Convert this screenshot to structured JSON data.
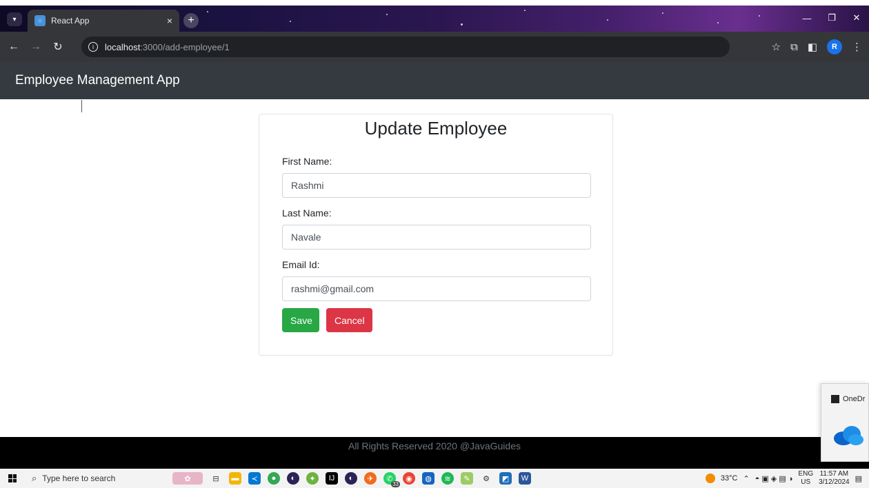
{
  "browser": {
    "tab_title": "React App",
    "tab_close": "×",
    "new_tab": "+",
    "url_host": "localhost",
    "url_path": ":3000/add-employee/1"
  },
  "app": {
    "brand": "Employee Management App"
  },
  "form": {
    "title": "Update Employee",
    "first_name_label": "First Name:",
    "first_name_value": "Rashmi",
    "last_name_label": "Last Name:",
    "last_name_value": "Navale",
    "email_label": "Email Id:",
    "email_value": "rashmi@gmail.com",
    "save_label": "Save",
    "cancel_label": "Cancel"
  },
  "footer": {
    "text": "All Rights Reserved 2020 @JavaGuides"
  },
  "onedrive": {
    "label": "OneDr"
  },
  "taskbar": {
    "search_placeholder": "Type here to search",
    "weather": "33°C",
    "lang_top": "ENG",
    "lang_bottom": "US",
    "time": "11:57 AM",
    "date": "3/12/2024",
    "whatsapp_badge": "33"
  },
  "colors": {
    "header_bg": "#343a40",
    "save": "#28a745",
    "cancel": "#dc3545",
    "footer_bg": "#000000"
  }
}
